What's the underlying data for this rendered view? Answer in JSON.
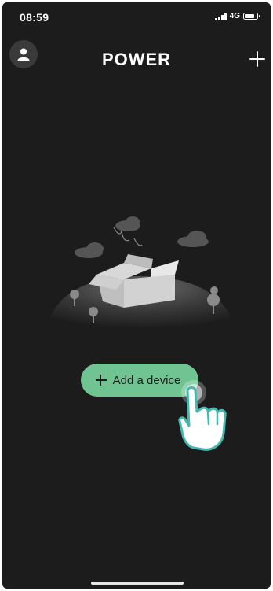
{
  "status_bar": {
    "time": "08:59",
    "network": "4G",
    "battery_level": 0.8
  },
  "header": {
    "title": "POWER",
    "avatar_icon": "user-icon",
    "add_icon": "plus-icon"
  },
  "main": {
    "add_device_label": "Add a device",
    "add_icon": "plus-icon",
    "illustration": "empty-box-illustration"
  },
  "colors": {
    "background": "#1c1c1c",
    "accent": "#6fc492",
    "text": "#ffffff"
  }
}
